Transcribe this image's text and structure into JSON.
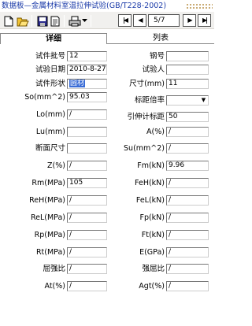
{
  "title": "数据板—金属材料室温拉伸试验(GB/T228-2002)",
  "toolbar": {
    "icons": [
      "new-icon",
      "open-icon",
      "save-icon",
      "preview-icon",
      "print-icon"
    ],
    "page_indicator": "5/7"
  },
  "tabs": [
    "详细",
    "列表"
  ],
  "left": [
    {
      "label": "试件批号",
      "value": "12"
    },
    {
      "label": "试验日期",
      "value": "2010-8-27"
    },
    {
      "label": "试件形状",
      "value": "圆材"
    },
    {
      "label": "So(mm^2)",
      "value": "95.03"
    },
    {
      "label": "Lo(mm)",
      "value": "/"
    },
    {
      "label": "Lu(mm)",
      "value": ""
    },
    {
      "label": "断面尺寸",
      "value": ""
    },
    {
      "label": "Z(%)",
      "value": "/"
    },
    {
      "label": "Rm(MPa)",
      "value": "105"
    },
    {
      "label": "ReH(MPa)",
      "value": "/"
    },
    {
      "label": "ReL(MPa)",
      "value": "/"
    },
    {
      "label": "Rp(MPa)",
      "value": "/"
    },
    {
      "label": "Rt(MPa)",
      "value": "/"
    },
    {
      "label": "屈强比",
      "value": "/"
    },
    {
      "label": "At(%)",
      "value": "/"
    }
  ],
  "right": [
    {
      "label": "钢号",
      "value": ""
    },
    {
      "label": "试验人",
      "value": ""
    },
    {
      "label": "尺寸(mm)",
      "value": "11"
    },
    {
      "label": "标距倍率",
      "value": ""
    },
    {
      "label": "引伸计标距",
      "value": "50"
    },
    {
      "label": "A(%)",
      "value": "/"
    },
    {
      "label": "Su(mm^2)",
      "value": "/"
    },
    {
      "label": "Fm(kN)",
      "value": "9.96"
    },
    {
      "label": "FeH(kN)",
      "value": "/"
    },
    {
      "label": "FeL(kN)",
      "value": "/"
    },
    {
      "label": "Fp(kN)",
      "value": "/"
    },
    {
      "label": "Ft(kN)",
      "value": "/"
    },
    {
      "label": "E(GPa)",
      "value": "/"
    },
    {
      "label": "强屈比",
      "value": "/"
    },
    {
      "label": "Agt(%)",
      "value": "/"
    }
  ]
}
